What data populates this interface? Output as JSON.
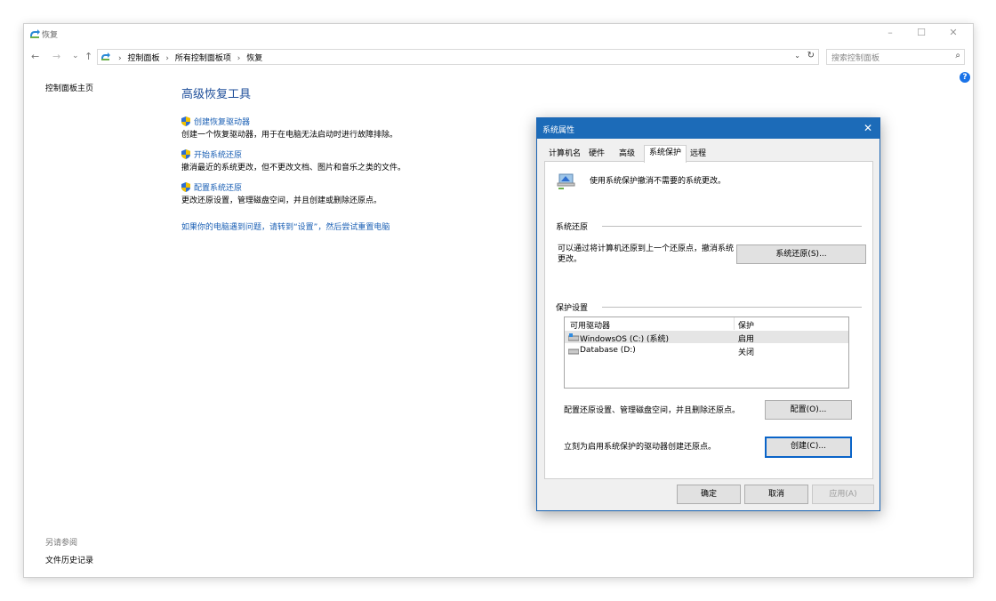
{
  "window": {
    "title": "恢复"
  },
  "nav": {
    "back": "←",
    "forward": "→",
    "recent": "⌄",
    "up": "↑"
  },
  "address": {
    "crumbs": [
      "控制面板",
      "所有控制面板项",
      "恢复"
    ],
    "sep": "›",
    "dropdown": "⌄",
    "refresh": "↻"
  },
  "search": {
    "placeholder": "搜索控制面板",
    "icon": "⌕"
  },
  "help": {
    "glyph": "?"
  },
  "sidebar": {
    "home": "控制面板主页",
    "see_also": "另请参阅",
    "file_history": "文件历史记录"
  },
  "main": {
    "heading": "高级恢复工具",
    "items": [
      {
        "link": "创建恢复驱动器",
        "desc": "创建一个恢复驱动器，用于在电脑无法启动时进行故障排除。"
      },
      {
        "link": "开始系统还原",
        "desc": "撤消最近的系统更改，但不更改文档、图片和音乐之类的文件。"
      },
      {
        "link": "配置系统还原",
        "desc": "更改还原设置，管理磁盘空间，并且创建或删除还原点。"
      }
    ],
    "reset_link": "如果你的电脑遇到问题，请转到“设置”，然后尝试重置电脑"
  },
  "dialog": {
    "title": "系统属性",
    "close": "✕",
    "tabs": [
      "计算机名",
      "硬件",
      "高级",
      "系统保护",
      "远程"
    ],
    "intro": "使用系统保护撤消不需要的系统更改。",
    "restore_group": "系统还原",
    "restore_desc": "可以通过将计算机还原到上一个还原点，撤消系统更改。",
    "restore_button": "系统还原(S)...",
    "protect_group": "保护设置",
    "columns": [
      "可用驱动器",
      "保护"
    ],
    "drives": [
      {
        "name": "WindowsOS (C:) (系统)",
        "status": "启用"
      },
      {
        "name": "Database (D:)",
        "status": "关闭"
      }
    ],
    "config_desc": "配置还原设置、管理磁盘空间，并且删除还原点。",
    "config_button": "配置(O)...",
    "create_desc": "立刻为启用系统保护的驱动器创建还原点。",
    "create_button": "创建(C)...",
    "ok": "确定",
    "cancel": "取消",
    "apply": "应用(A)"
  },
  "colors": {
    "link": "#1a5fb4",
    "heading": "#1e4e9a",
    "dialog_title": "#1c6bb8"
  }
}
